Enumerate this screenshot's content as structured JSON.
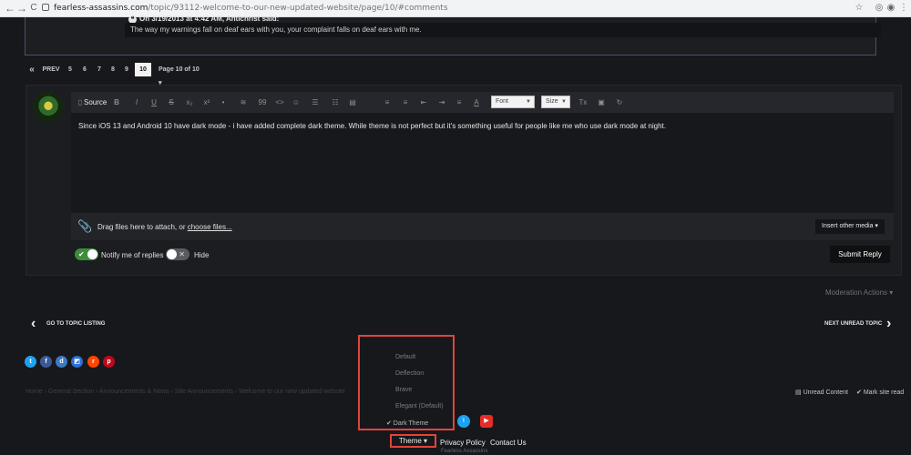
{
  "browser": {
    "url_host": "fearless-assassins.com",
    "url_path": "/topic/93112-welcome-to-our-new-updated-website/page/10/#comments",
    "back_icon": "←",
    "forward_icon": "→",
    "reload_icon": "C"
  },
  "quote": {
    "header": "On 3/19/2013 at 4:42 AM, Antichrist said:",
    "body": "The way my warnings fall on deaf ears with you,  your complaint falls on deaf ears with me."
  },
  "pagination": {
    "first": "«",
    "prev": "PREV",
    "pages": [
      "5",
      "6",
      "7",
      "8",
      "9",
      "10"
    ],
    "current": "10",
    "page_of": "Page 10 of 10 ▾"
  },
  "toolbar": {
    "source": "Source",
    "font": "Font",
    "size": "Size",
    "icons": [
      "B",
      "I",
      "U",
      "S",
      "x₂",
      "x²",
      "•",
      "≋",
      "99",
      "<>",
      "☺",
      "☰",
      "☷",
      "▤",
      "≡",
      "≡",
      "⇤",
      "⇥",
      "≡",
      "A",
      "",
      "",
      "Tx",
      "▣",
      "↻"
    ]
  },
  "editor": {
    "text": "Since iOS 13 and Android 10 have dark mode - i have added complete dark theme. While theme is not perfect but it's something useful for people like me who use dark mode at night."
  },
  "attach": {
    "drag_text": "Drag files here to attach, or ",
    "choose_link": "choose files...",
    "insert_media": "Insert other media ▾"
  },
  "options": {
    "notify_label": "Notify me of replies",
    "hide_label": "Hide",
    "submit": "Submit Reply"
  },
  "moderation": "Moderation Actions ▾",
  "topic_nav": {
    "back": "GO TO TOPIC LISTING",
    "next": "NEXT UNREAD TOPIC"
  },
  "breadcrumb": {
    "text": "Home  ›  General Section  ›  Announcements & News  ›  Site Announcements  ›  Welcome to our new updated website",
    "unread": "Unread Content",
    "mark_read": "Mark site read"
  },
  "theme_menu": {
    "items": [
      "Default",
      "Deflection",
      "Brave",
      "Elegant (Default)",
      "✔ Dark Theme"
    ]
  },
  "footer": {
    "theme": "Theme ▾",
    "privacy": "Privacy Policy",
    "contact": "Contact Us",
    "small": "Fearless Assassins"
  },
  "colors": {
    "background": "#17181c",
    "highlight": "#e0453a",
    "toggle_on": "#3e8d3a"
  }
}
